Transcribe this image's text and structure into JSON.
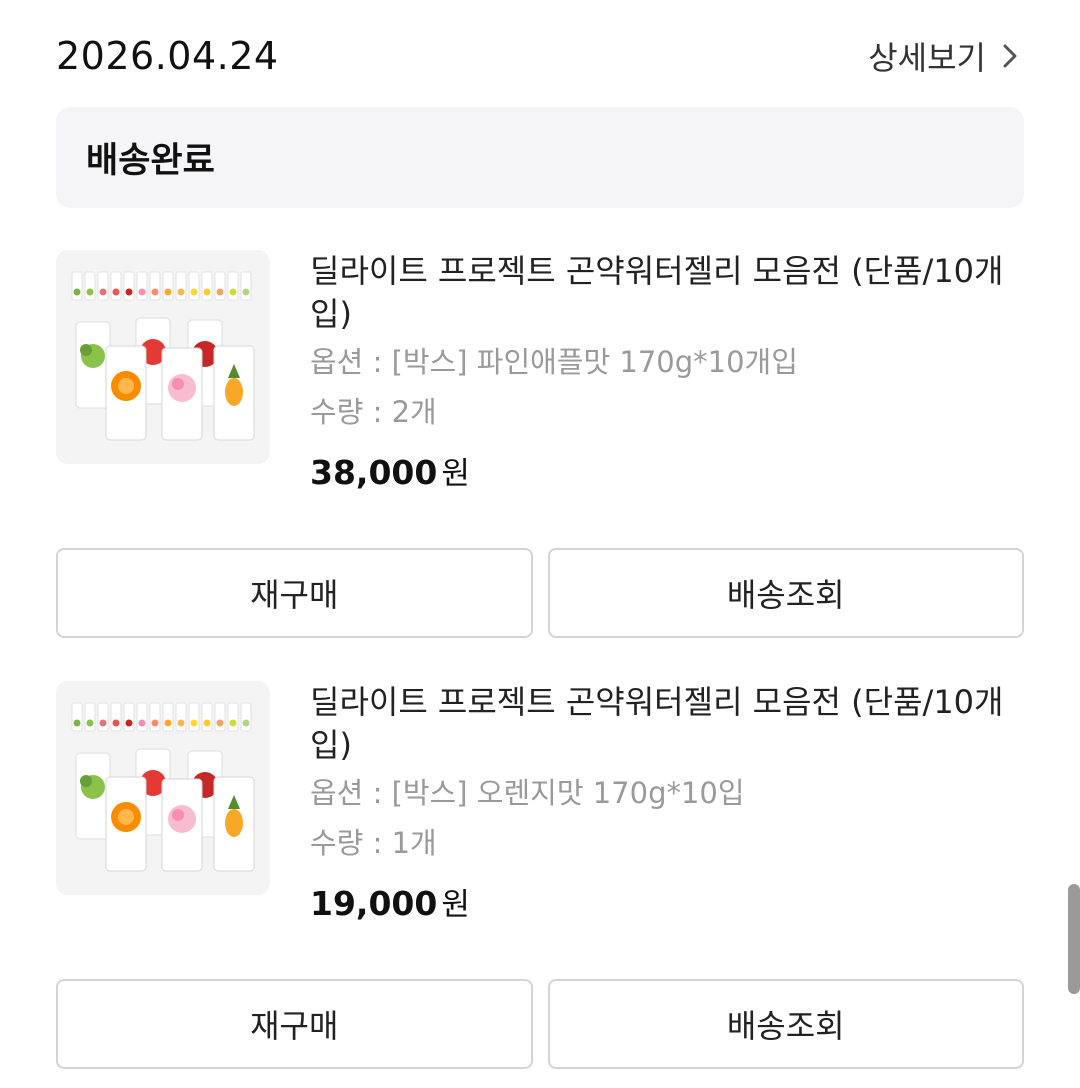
{
  "header": {
    "order_date": "2026.04.24",
    "detail_label": "상세보기"
  },
  "status": {
    "label": "배송완료"
  },
  "items": [
    {
      "name": "딜라이트 프로젝트 곤약워터젤리 모음전 (단품/10개입)",
      "option": "옵션 : [박스] 파인애플맛 170g*10개입",
      "quantity": "수량 : 2개",
      "price": "38,000",
      "currency": "원",
      "rebuy_label": "재구매",
      "track_label": "배송조회"
    },
    {
      "name": "딜라이트 프로젝트 곤약워터젤리 모음전 (단품/10개입)",
      "option": "옵션 : [박스] 오렌지맛 170g*10입",
      "quantity": "수량 : 1개",
      "price": "19,000",
      "currency": "원",
      "rebuy_label": "재구매",
      "track_label": "배송조회"
    }
  ],
  "colors": {
    "status_bg": "#f5f5f7",
    "muted_text": "#9a9a9a",
    "button_border": "#d4d4d4"
  }
}
